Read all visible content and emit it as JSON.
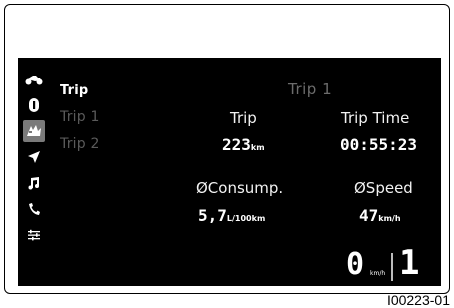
{
  "sidebar": {
    "icons": [
      "motorcycle-icon",
      "info-icon",
      "trip-icon",
      "navigation-icon",
      "music-icon",
      "phone-icon",
      "settings-icon"
    ],
    "selected": "trip-icon"
  },
  "menu": {
    "items": [
      {
        "label": "Trip",
        "state": "active"
      },
      {
        "label": "Trip 1",
        "state": "inactive"
      },
      {
        "label": "Trip 2",
        "state": "inactive"
      }
    ]
  },
  "panel": {
    "title": "Trip 1",
    "trip_label": "Trip",
    "trip_value": "223",
    "trip_unit": "km",
    "trip_time_label": "Trip Time",
    "trip_time_value": "00:55:23",
    "consumption_label": "ØConsump.",
    "consumption_value": "5,7",
    "consumption_unit": "L/100km",
    "speed_label": "ØSpeed",
    "speed_value": "47",
    "speed_unit": "km/h"
  },
  "status": {
    "speed": "0",
    "speed_unit": "km/h",
    "gear": "1"
  },
  "figure_code": "I00223-01",
  "colors": {
    "screen_bg": "#000000",
    "text": "#ffffff",
    "muted": "#5a5a5a",
    "selected_bg": "#7a7a7a"
  }
}
